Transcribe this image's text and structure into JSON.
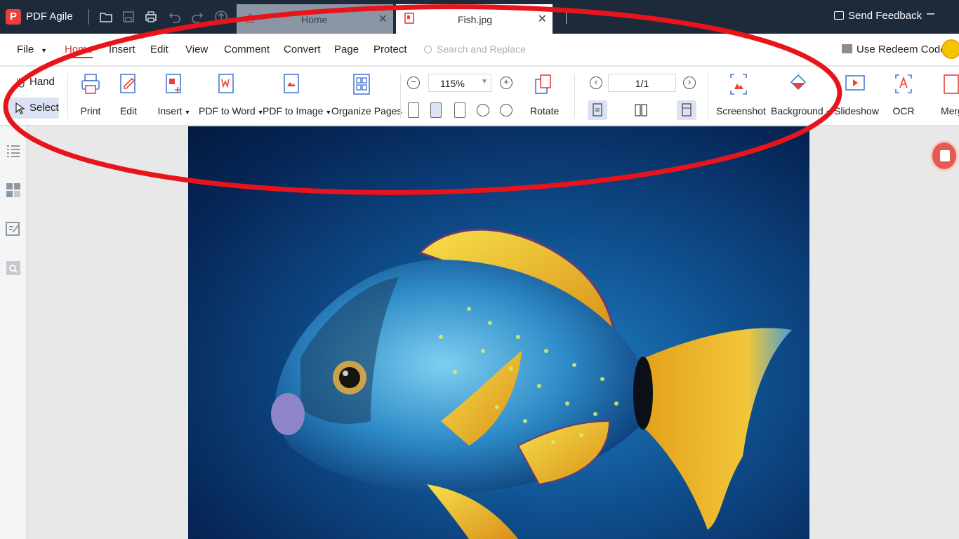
{
  "app": {
    "name": "PDF Agile",
    "logo_letter": "P"
  },
  "tabs": [
    {
      "label": "Home",
      "close": "✕"
    },
    {
      "label": "Fish.jpg",
      "close": "✕"
    }
  ],
  "titlebar": {
    "feedback": "Send Feedback",
    "minimize": "–"
  },
  "menu": {
    "file": "File",
    "items": [
      "Home",
      "Insert",
      "Edit",
      "View",
      "Comment",
      "Convert",
      "Page",
      "Protect"
    ],
    "active": "Home",
    "search_placeholder": "Search and Replace",
    "redeem": "Use Redeem Code"
  },
  "toolbar": {
    "hand": "Hand",
    "select": "Select",
    "print": "Print",
    "edit": "Edit",
    "insert": "Insert",
    "pdf_to_word": "PDF to Word",
    "pdf_to_image": "PDF to Image",
    "organize_pages": "Organize Pages",
    "zoom": "115%",
    "rotate": "Rotate",
    "page": "1/1",
    "screenshot": "Screenshot",
    "background": "Background",
    "slideshow": "Slideshow",
    "ocr": "OCR",
    "merge": "Merg"
  },
  "colors": {
    "accent": "#d9342b",
    "titlebar": "#1d2a3a",
    "annotation": "#e8141b"
  },
  "icons": [
    "hand-icon",
    "cursor-icon",
    "printer-icon",
    "edit-icon",
    "insert-icon",
    "pdf-word-icon",
    "pdf-image-icon",
    "organize-icon",
    "zoom-out-icon",
    "zoom-in-icon",
    "rotate-icon",
    "screenshot-icon",
    "background-icon",
    "slideshow-icon",
    "ocr-icon",
    "merge-icon"
  ]
}
